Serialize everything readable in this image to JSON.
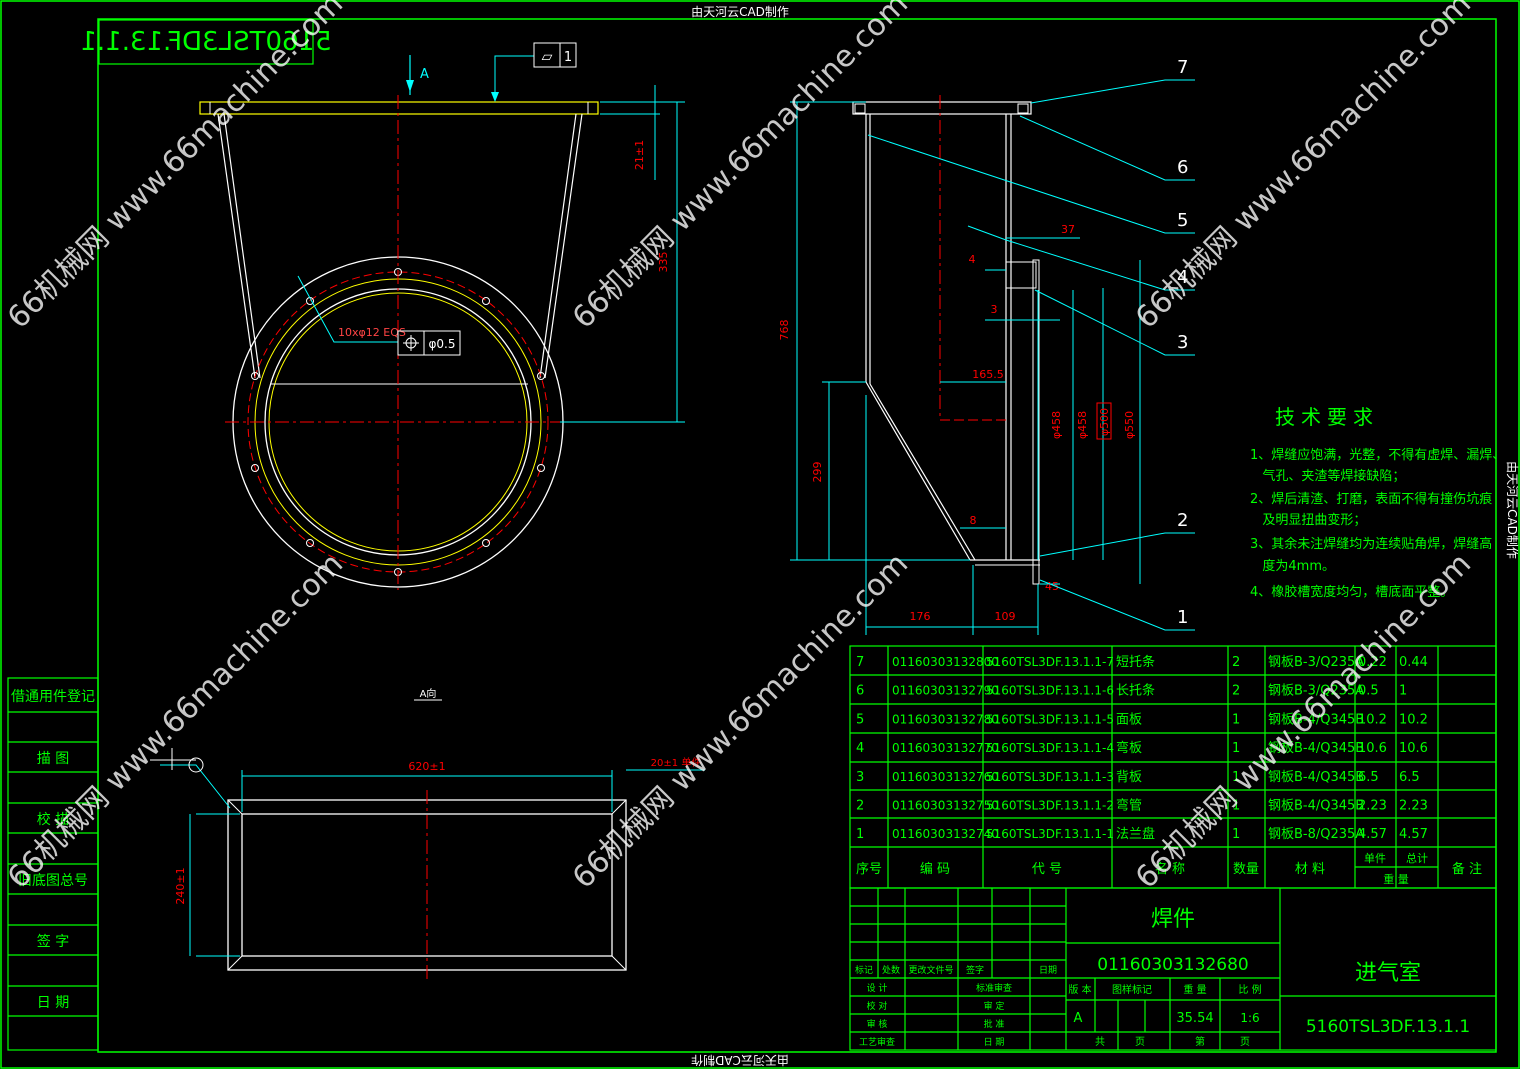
{
  "cad_credit": "由天河云CAD制作",
  "drawing_code_mirrored": "5160TSL3DF.13.1.1",
  "view_arrow_label": "A",
  "view_label": "A向",
  "flatness_tol_symbol": "▱",
  "flatness_tol_value": "1",
  "hole_note": "10xφ12 EQS",
  "position_tol_value": "φ0.5",
  "dims": {
    "d21": "21±1",
    "d335": "335",
    "d768": "768",
    "d299": "299",
    "d37": "37",
    "d4": "4",
    "d3": "3",
    "d1655": "165.5",
    "d8": "8",
    "d45": "45",
    "d176": "176",
    "d109": "109",
    "phi458a": "φ458",
    "phi458b": "φ458",
    "phi500": "φ500",
    "phi550": "φ550",
    "d620": "620±1",
    "d240": "240±1",
    "d20": "20±1 单件"
  },
  "balloons": [
    "7",
    "6",
    "5",
    "4",
    "3",
    "2",
    "1"
  ],
  "tech_title": "技术要求",
  "tech_lines": [
    "1、焊缝应饱满，光整，不得有虚焊、漏焊、",
    "   气孔、夹渣等焊接缺陷；",
    "2、焊后清渣、打磨，表面不得有撞伤坑痕",
    "   及明显扭曲变形；",
    "3、其余未注焊缝均为连续贴角焊，焊缝高",
    "   度为4mm。",
    "4、橡胶槽宽度均匀，槽底面平整。"
  ],
  "bom_rows": [
    [
      "7",
      "01160303132800",
      "5160TSL3DF.13.1.1-7",
      "短托条",
      "2",
      "钢板B-3/Q235A",
      "0.22",
      "0.44"
    ],
    [
      "6",
      "01160303132790",
      "5160TSL3DF.13.1.1-6",
      "长托条",
      "2",
      "钢板B-3/Q235A",
      "0.5",
      "1"
    ],
    [
      "5",
      "01160303132780",
      "5160TSL3DF.13.1.1-5",
      "面板",
      "1",
      "钢板B-4/Q345B",
      "10.2",
      "10.2"
    ],
    [
      "4",
      "01160303132770",
      "5160TSL3DF.13.1.1-4",
      "弯板",
      "1",
      "钢板B-4/Q345B",
      "10.6",
      "10.6"
    ],
    [
      "3",
      "01160303132760",
      "5160TSL3DF.13.1.1-3",
      "背板",
      "1",
      "钢板B-4/Q345B",
      "6.5",
      "6.5"
    ],
    [
      "2",
      "01160303132750",
      "5160TSL3DF.13.1.1-2",
      "弯管",
      "1",
      "钢板B-4/Q345B",
      "2.23",
      "2.23"
    ],
    [
      "1",
      "01160303132740",
      "5160TSL3DF.13.1.1-1",
      "法兰盘",
      "1",
      "钢板B-8/Q235A",
      "4.57",
      "4.57"
    ]
  ],
  "bom_header": {
    "seq": "序号",
    "code": "编  码",
    "drawing": "代  号",
    "name": "名  称",
    "qty": "数量",
    "material": "材  料",
    "unit": "单件",
    "total": "总计",
    "weight": "重  量",
    "remark": "备 注"
  },
  "title_block": {
    "type": "焊件",
    "code": "01160303132680",
    "name": "进气室",
    "drawing_no": "5160TSL3DF.13.1.1",
    "version": "A",
    "weight": "35.54",
    "scale": "1:6",
    "rev_labels": [
      "标记",
      "处数",
      "更改文件号",
      "签字",
      "日期"
    ],
    "sign_labels": [
      "设  计",
      "校  对",
      "审  核",
      "工艺审查"
    ],
    "sign_labels2": [
      "标准审查",
      "审  定",
      "批  准",
      "日  期"
    ],
    "info_labels": [
      "版 本",
      "图样标记",
      "重  量",
      "比  例"
    ],
    "sheet_labels": [
      "共",
      "页",
      "第",
      "页"
    ]
  },
  "left_panel": [
    "借通用件登记",
    "描  图",
    "校  描",
    "旧底图总号",
    "签  字",
    "日  期"
  ],
  "watermark": [
    "66机械网 www.66machine.com",
    "66机械网 www.66machine.com",
    "66机械网 www.66machine.com",
    "66机械网 www.66machine.com",
    "66机械网 www.66machine.com",
    "66机械网 www.66machine.com"
  ],
  "colors": {
    "green": "#00ff00",
    "red": "#ff0000",
    "cyan": "#00ffff",
    "white": "#ffffff",
    "yellow": "#ffff00"
  }
}
